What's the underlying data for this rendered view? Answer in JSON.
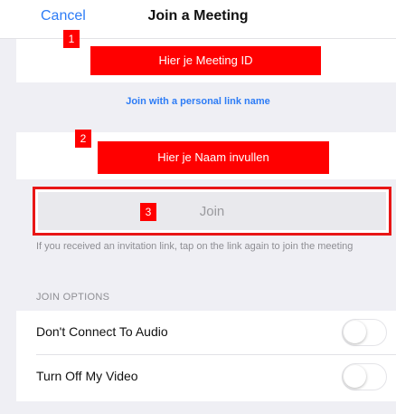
{
  "nav": {
    "cancel_label": "Cancel",
    "title": "Join a Meeting"
  },
  "step_badges": [
    "1",
    "2",
    "3"
  ],
  "meeting_id_field": {
    "overlay_text": "Hier je Meeting ID"
  },
  "personal_link": {
    "label": "Join with a personal link name"
  },
  "name_field": {
    "overlay_text": "Hier je Naam invullen"
  },
  "join_button": {
    "label": "Join"
  },
  "hint": {
    "text": "If you received an invitation link, tap on the link again to join the meeting"
  },
  "join_options": {
    "header": "JOIN OPTIONS",
    "items": [
      {
        "label": "Don't Connect To Audio",
        "enabled": false
      },
      {
        "label": "Turn Off My Video",
        "enabled": false
      }
    ]
  },
  "colors": {
    "accent": "#2d7cf6",
    "annotation_red": "#ff0000"
  }
}
